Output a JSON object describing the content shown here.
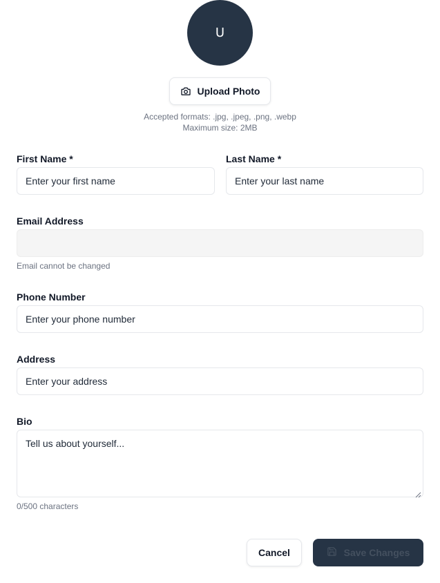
{
  "avatar": {
    "initial": "U",
    "bg_color": "#263445"
  },
  "upload": {
    "label": "Upload Photo",
    "icon": "camera-icon"
  },
  "photo_hints": {
    "formats": "Accepted formats: .jpg, .jpeg, .png, .webp",
    "max_size": "Maximum size: 2MB"
  },
  "form": {
    "first_name": {
      "label": "First Name *",
      "placeholder": "Enter your first name"
    },
    "last_name": {
      "label": "Last Name *",
      "placeholder": "Enter your last name"
    },
    "email": {
      "label": "Email Address",
      "value": "",
      "helper": "Email cannot be changed"
    },
    "phone": {
      "label": "Phone Number",
      "placeholder": "Enter your phone number"
    },
    "address": {
      "label": "Address",
      "placeholder": "Enter your address"
    },
    "bio": {
      "label": "Bio",
      "placeholder": "Tell us about yourself...",
      "counter": "0/500 characters"
    }
  },
  "actions": {
    "cancel_label": "Cancel",
    "save_label": "Save Changes",
    "save_icon": "save-icon"
  }
}
